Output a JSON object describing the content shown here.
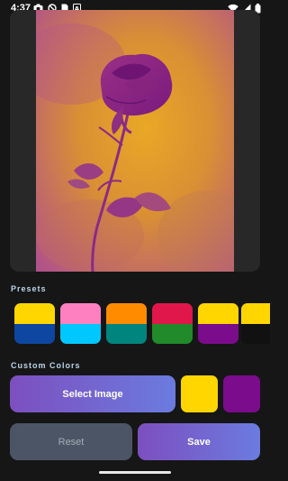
{
  "status_bar": {
    "time": "4:37",
    "left_icons": [
      "camera-icon",
      "block-icon",
      "sim-card-icon",
      "a-icon"
    ],
    "right_icons": [
      "wifi-icon",
      "cellular-signal-icon",
      "battery-icon"
    ]
  },
  "preview": {
    "image_description_icon": "rose-image",
    "duotone_colors": {
      "shadow": "#8e1f86",
      "highlight": "#e6a524"
    }
  },
  "sections": {
    "presets_label": "Presets",
    "custom_colors_label": "Custom Colors"
  },
  "presets": [
    {
      "top": "#ffd600",
      "bottom": "#0d47a1"
    },
    {
      "top": "#ff80c0",
      "bottom": "#00c8ff"
    },
    {
      "top": "#ff8c00",
      "bottom": "#00857e"
    },
    {
      "top": "#e0174a",
      "bottom": "#218a2a"
    },
    {
      "top": "#ffd600",
      "bottom": "#7b0c8c"
    },
    {
      "top": "#ffd600",
      "bottom": "#111111"
    }
  ],
  "custom_colors": {
    "select_image_label": "Select Image",
    "color_1": "#ffd600",
    "color_2": "#7b0c8c"
  },
  "actions": {
    "reset_label": "Reset",
    "save_label": "Save"
  }
}
